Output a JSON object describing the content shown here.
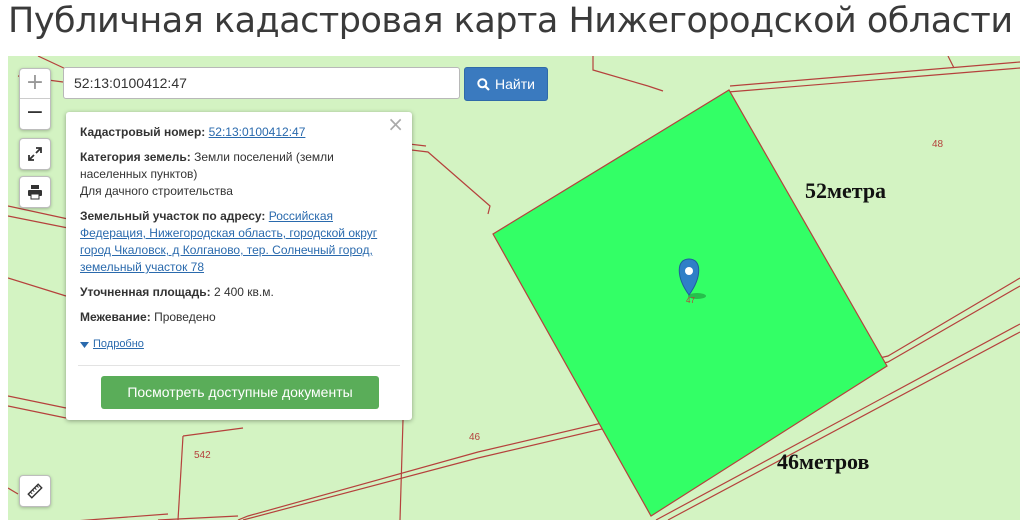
{
  "header": {
    "title": "Публичная кадастровая карта Нижегородской области"
  },
  "search": {
    "value": "52:13:0100412:47",
    "button_label": "Найти"
  },
  "controls": {
    "zoom_in": "+",
    "zoom_out": "−"
  },
  "popup": {
    "close": "×",
    "cadastral_label": "Кадастровый номер:",
    "cadastral_value": "52:13:0100412:47",
    "category_label": "Категория земель:",
    "category_value": "Земли поселений (земли населенных пунктов)",
    "category_use": "Для дачного строительства",
    "address_label": "Земельный участок по адресу:",
    "address_value": "Российская Федерация, Нижегородская область, городской округ город Чкаловск, д Колганово, тер. Солнечный город, земельный участок 78",
    "area_label": "Уточненная площадь:",
    "area_value": "2 400 кв.м.",
    "survey_label": "Межевание:",
    "survey_value": "Проведено",
    "details_link": "Подробно",
    "docs_button": "Посмотреть доступные документы"
  },
  "map": {
    "parcel_labels": [
      "48",
      "46",
      "542"
    ],
    "marker_label": "47",
    "annotations": {
      "side_top": "52метра",
      "side_bottom": "46метров"
    },
    "colors": {
      "background": "#d3f3c2",
      "parcel_fill": "#33ff66",
      "boundary": "#b5413c",
      "marker": "#2f7fc7"
    }
  }
}
